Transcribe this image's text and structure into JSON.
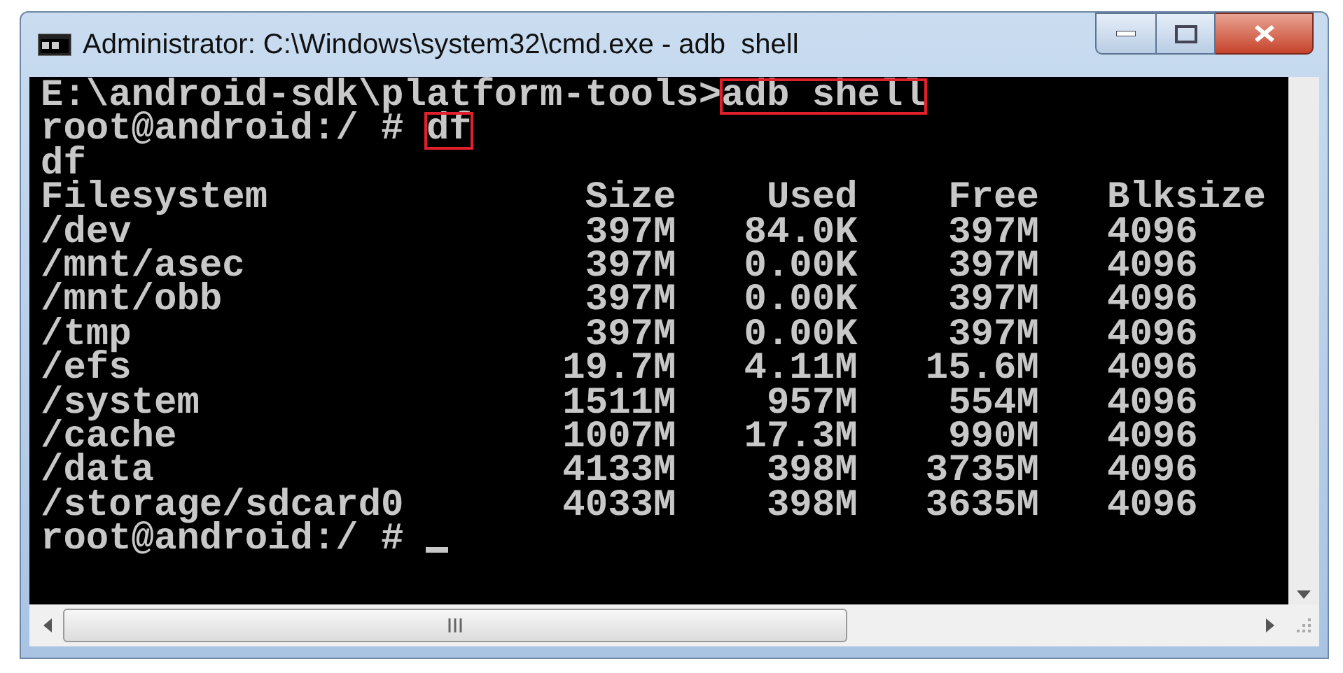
{
  "window": {
    "title": "Administrator: C:\\Windows\\system32\\cmd.exe - adb  shell"
  },
  "console": {
    "lines": [
      {
        "segments": [
          {
            "text": "E:\\android-sdk\\platform-tools>",
            "boxed": false
          },
          {
            "text": "adb shell",
            "boxed": true
          }
        ],
        "cursor": false
      },
      {
        "segments": [
          {
            "text": "root@android:/ # ",
            "boxed": false
          },
          {
            "text": "df",
            "boxed": true
          }
        ],
        "cursor": false
      },
      {
        "segments": [
          {
            "text": "df",
            "boxed": false
          }
        ],
        "cursor": false
      },
      {
        "segments": [
          {
            "text": "Filesystem              Size    Used    Free   Blksize",
            "boxed": false
          }
        ],
        "cursor": false
      },
      {
        "segments": [
          {
            "text": "/dev                    397M   84.0K    397M   4096",
            "boxed": false
          }
        ],
        "cursor": false
      },
      {
        "segments": [
          {
            "text": "/mnt/asec               397M   0.00K    397M   4096",
            "boxed": false
          }
        ],
        "cursor": false
      },
      {
        "segments": [
          {
            "text": "/mnt/obb                397M   0.00K    397M   4096",
            "boxed": false
          }
        ],
        "cursor": false
      },
      {
        "segments": [
          {
            "text": "/tmp                    397M   0.00K    397M   4096",
            "boxed": false
          }
        ],
        "cursor": false
      },
      {
        "segments": [
          {
            "text": "/efs                   19.7M   4.11M   15.6M   4096",
            "boxed": false
          }
        ],
        "cursor": false
      },
      {
        "segments": [
          {
            "text": "/system                1511M    957M    554M   4096",
            "boxed": false
          }
        ],
        "cursor": false
      },
      {
        "segments": [
          {
            "text": "/cache                 1007M   17.3M    990M   4096",
            "boxed": false
          }
        ],
        "cursor": false
      },
      {
        "segments": [
          {
            "text": "/data                  4133M    398M   3735M   4096",
            "boxed": false
          }
        ],
        "cursor": false
      },
      {
        "segments": [
          {
            "text": "/storage/sdcard0       4033M    398M   3635M   4096",
            "boxed": false
          }
        ],
        "cursor": false
      },
      {
        "segments": [
          {
            "text": "root@android:/ #",
            "boxed": false
          }
        ],
        "cursor": true
      }
    ]
  }
}
